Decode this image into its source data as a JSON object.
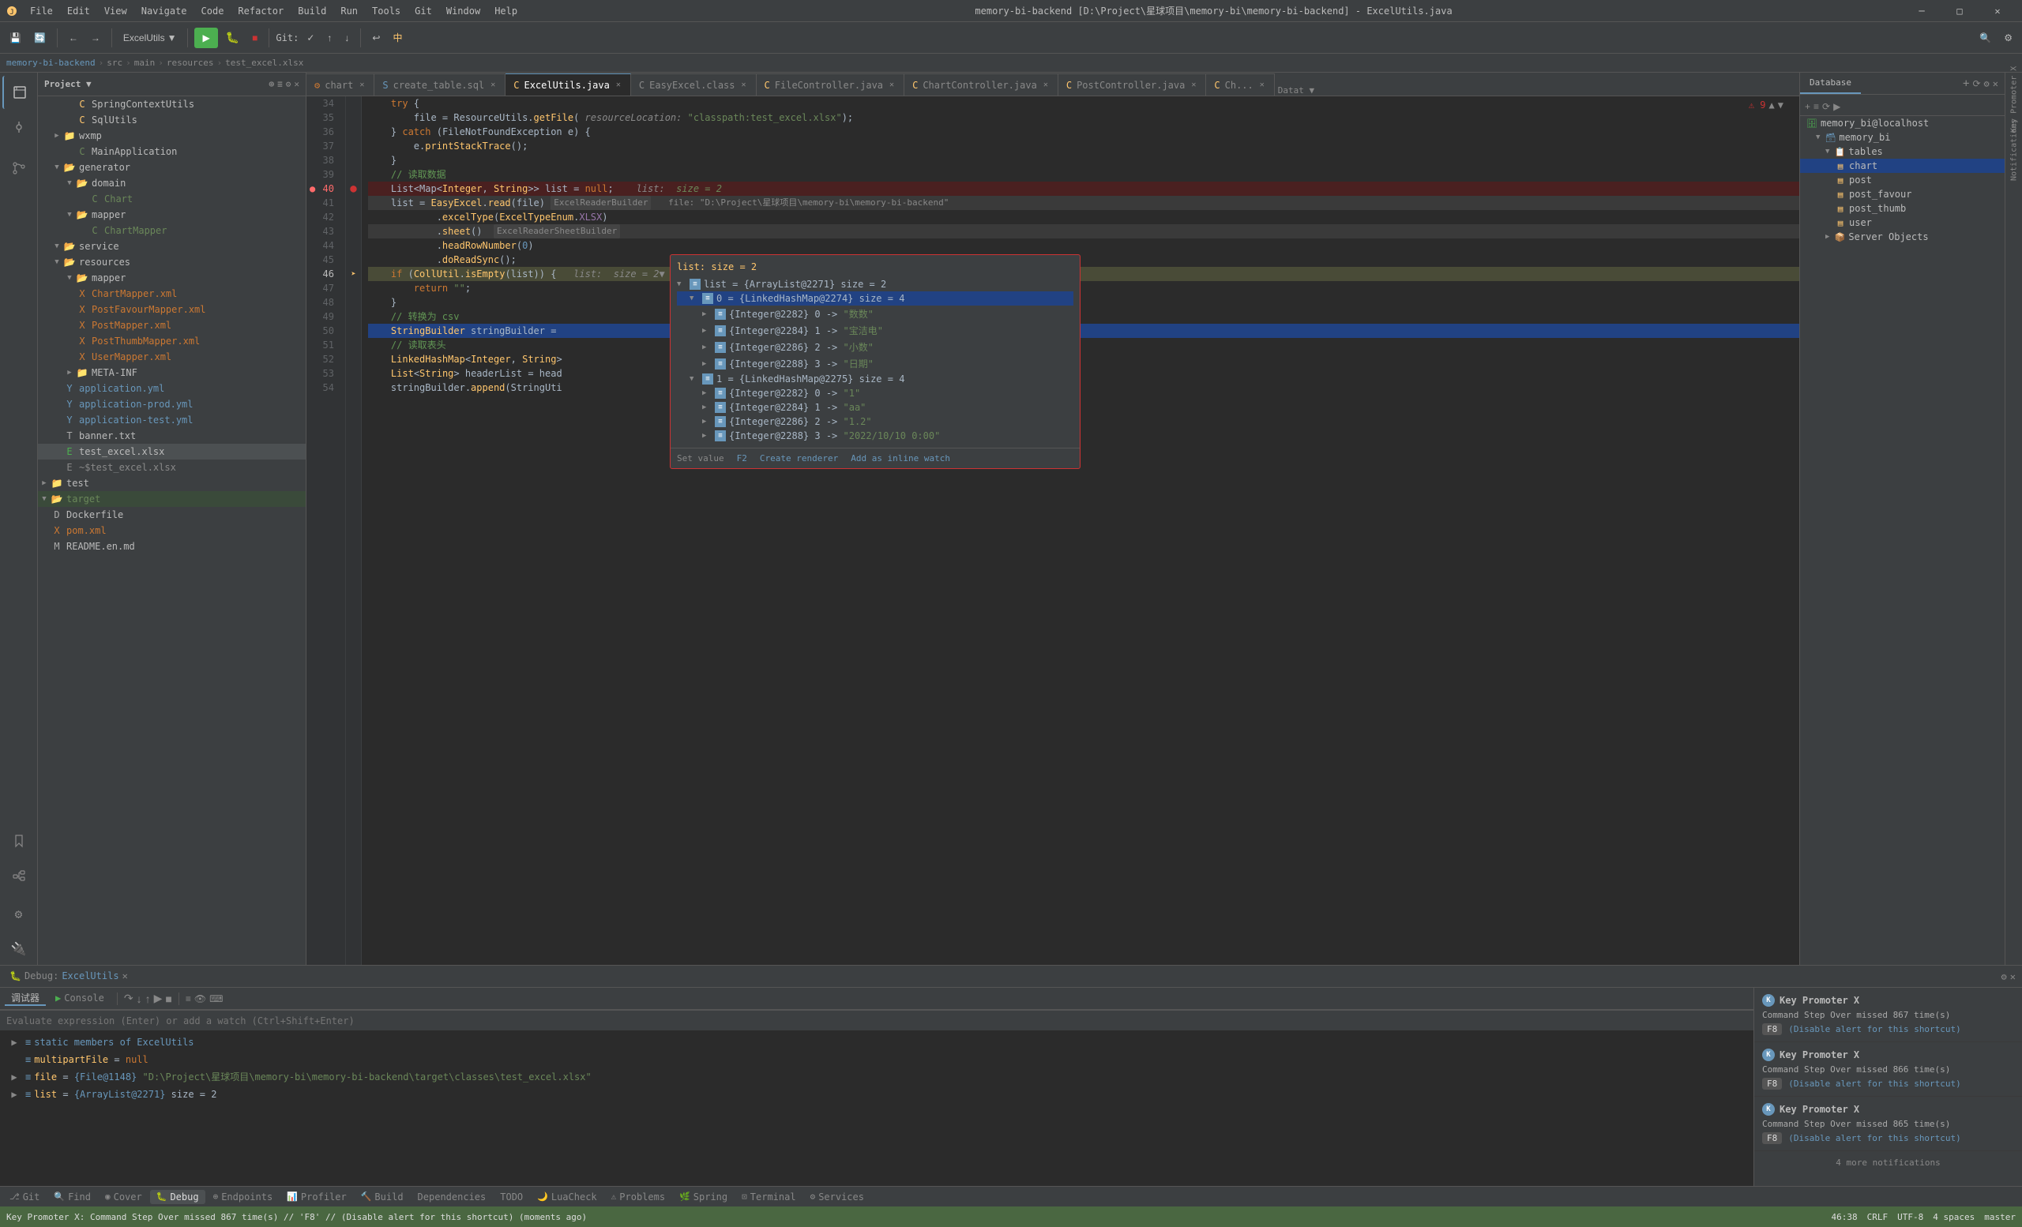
{
  "titleBar": {
    "title": "memory-bi-backend [D:\\Project\\星球项目\\memory-bi\\memory-bi-backend] - ExcelUtils.java",
    "menuItems": [
      "File",
      "Edit",
      "View",
      "Navigate",
      "Code",
      "Refactor",
      "Build",
      "Run",
      "Tools",
      "Git",
      "Window",
      "Help"
    ],
    "controls": [
      "─",
      "□",
      "✕"
    ]
  },
  "toolbar": {
    "projectName": "ExcelUtils",
    "gitStatus": "Git:",
    "runBtn": "▶",
    "debugBtn": "🐛"
  },
  "breadcrumb": {
    "items": [
      "memory-bi-backend",
      "src",
      "main",
      "resources",
      "test_excel.xlsx"
    ]
  },
  "tabs": [
    {
      "label": "chart",
      "icon": "xml",
      "active": false,
      "closeable": true
    },
    {
      "label": "create_table.sql",
      "icon": "sql",
      "active": false,
      "closeable": true
    },
    {
      "label": "ExcelUtils.java",
      "icon": "java",
      "active": true,
      "closeable": true
    },
    {
      "label": "EasyExcel.class",
      "icon": "class",
      "active": false,
      "closeable": true
    },
    {
      "label": "FileController.java",
      "icon": "java",
      "active": false,
      "closeable": true
    },
    {
      "label": "ChartController.java",
      "icon": "java",
      "active": false,
      "closeable": true
    },
    {
      "label": "PostController.java",
      "icon": "java",
      "active": false,
      "closeable": true
    },
    {
      "label": "Ch...",
      "icon": "java",
      "active": false,
      "closeable": true
    }
  ],
  "codeLines": [
    {
      "num": 34,
      "code": "    try {"
    },
    {
      "num": 35,
      "code": "        file = ResourceUtils.getFile( resourceLocation: \"classpath:test_excel.xlsx\");"
    },
    {
      "num": 36,
      "code": "    } catch (FileNotFoundException e) {"
    },
    {
      "num": 37,
      "code": "        e.printStackTrace();"
    },
    {
      "num": 38,
      "code": "    }"
    },
    {
      "num": 39,
      "code": "    // 读取数据"
    },
    {
      "num": 40,
      "code": "    List<Map<Integer, String>> list = null;    list:  size = 2",
      "debug": true,
      "breakpoint": true
    },
    {
      "num": 41,
      "code": "    list = EasyExcel.read(file) ExcelReaderBuilder   file: \"D:\\Project\\星球项目\\memory-bi\\memory-bi-backend\""
    },
    {
      "num": 42,
      "code": "            .excelType(ExcelTypeEnum.XLSX)"
    },
    {
      "num": 43,
      "code": "            .sheet()  ExcelReaderSheetBuilder"
    },
    {
      "num": 44,
      "code": "            .headRowNumber(0)"
    },
    {
      "num": 45,
      "code": "            .doReadSync();"
    },
    {
      "num": 46,
      "code": "    if (CollUtil.isEmpty(list)) {   list:  size = 2▼",
      "current": true
    },
    {
      "num": 47,
      "code": "        return \"\";"
    },
    {
      "num": 48,
      "code": "    }"
    },
    {
      "num": 49,
      "code": "    // 转换为 csv"
    },
    {
      "num": 50,
      "code": "    StringBuilder stringBuilder =",
      "selected": true
    },
    {
      "num": 51,
      "code": "    // 读取表头"
    },
    {
      "num": 52,
      "code": "    LinkedHashMap<Integer, String>"
    },
    {
      "num": 53,
      "code": "    List<String> headerList = head"
    },
    {
      "num": 54,
      "code": "    stringBuilder.append(StringUti"
    }
  ],
  "debugPopup": {
    "title": "list:  size = 2",
    "items": [
      {
        "label": "list = {ArrayList@2271}  size = 2",
        "expanded": true,
        "children": [
          {
            "label": "0 = {LinkedHashMap@2274}  size = 4",
            "expanded": true,
            "selected": true,
            "children": [
              {
                "label": "{Integer@2282} 0 -> \"数数\""
              },
              {
                "label": "{Integer@2284} 1 -> \"宝洁电\""
              },
              {
                "label": "{Integer@2286} 2 -> \"小数\""
              },
              {
                "label": "{Integer@2288} 3 -> \"日期\""
              }
            ]
          },
          {
            "label": "1 = {LinkedHashMap@2275}  size = 4",
            "expanded": true,
            "children": [
              {
                "label": "{Integer@2282} 0 -> \"1\""
              },
              {
                "label": "{Integer@2284} 1 -> \"aa\""
              },
              {
                "label": "{Integer@2286} 2 -> \"1.2\""
              },
              {
                "label": "{Integer@2288} 3 -> \"2022/10/10 0:00\""
              }
            ]
          }
        ]
      }
    ],
    "footer": {
      "setValueKey": "F2",
      "createRenderer": "Create renderer",
      "addInlineWatch": "Add as inline watch"
    }
  },
  "projectTree": {
    "title": "Project",
    "items": [
      {
        "label": "SpringContextUtils",
        "type": "java",
        "indent": 2
      },
      {
        "label": "SqlUtils",
        "type": "java",
        "indent": 2
      },
      {
        "label": "wxmp",
        "type": "folder",
        "indent": 1,
        "expanded": false
      },
      {
        "label": "MainApplication",
        "type": "java",
        "indent": 2
      },
      {
        "label": "generator",
        "type": "folder",
        "indent": 1,
        "expanded": true
      },
      {
        "label": "domain",
        "type": "folder",
        "indent": 2,
        "expanded": true
      },
      {
        "label": "Chart",
        "type": "java-green",
        "indent": 3
      },
      {
        "label": "mapper",
        "type": "folder",
        "indent": 2,
        "expanded": true
      },
      {
        "label": "ChartMapper",
        "type": "java-green",
        "indent": 3
      },
      {
        "label": "service",
        "type": "folder",
        "indent": 1,
        "expanded": true
      },
      {
        "label": "resources",
        "type": "folder",
        "indent": 1,
        "expanded": true
      },
      {
        "label": "mapper",
        "type": "folder",
        "indent": 2,
        "expanded": true
      },
      {
        "label": "ChartMapper.xml",
        "type": "xml",
        "indent": 3
      },
      {
        "label": "PostFavourMapper.xml",
        "type": "xml",
        "indent": 3
      },
      {
        "label": "PostMapper.xml",
        "type": "xml",
        "indent": 3
      },
      {
        "label": "PostThumbMapper.xml",
        "type": "xml",
        "indent": 3
      },
      {
        "label": "UserMapper.xml",
        "type": "xml",
        "indent": 3
      },
      {
        "label": "META-INF",
        "type": "folder",
        "indent": 2,
        "expanded": false
      },
      {
        "label": "application.yml",
        "type": "yml",
        "indent": 2
      },
      {
        "label": "application-prod.yml",
        "type": "yml",
        "indent": 2
      },
      {
        "label": "application-test.yml",
        "type": "yml",
        "indent": 2
      },
      {
        "label": "banner.txt",
        "type": "txt",
        "indent": 2
      },
      {
        "label": "test_excel.xlsx",
        "type": "xlsx",
        "indent": 2,
        "selected": true
      },
      {
        "label": "~$test_excel.xlsx",
        "type": "xlsx",
        "indent": 2
      },
      {
        "label": "test",
        "type": "folder",
        "indent": 0,
        "expanded": false
      },
      {
        "label": "target",
        "type": "folder",
        "indent": 0,
        "expanded": true,
        "highlighted": true
      },
      {
        "label": "Dockerfile",
        "type": "file",
        "indent": 1
      },
      {
        "label": "pom.xml",
        "type": "xml",
        "indent": 1
      },
      {
        "label": "README.en.md",
        "type": "md",
        "indent": 1
      }
    ]
  },
  "database": {
    "title": "Database",
    "server": "memory_bi@localhost",
    "database": "memory_bi",
    "tables": [
      "chart",
      "post",
      "post_favour",
      "post_thumb",
      "user"
    ],
    "serverObjects": "Server Objects"
  },
  "debugConsole": {
    "tabs": [
      "调试器",
      "Console"
    ],
    "variables": [
      {
        "label": "static members of ExcelUtils"
      },
      {
        "label": "multipartFile = null"
      },
      {
        "label": "file = {File@1148} \"D:\\Project\\星球项目\\memory-bi\\memory-bi-backend\\target\\classes\\test_excel.xlsx\""
      },
      {
        "label": "list = {ArrayList@2271}  size = 2"
      }
    ],
    "inputPlaceholder": "Evaluate expression (Enter) or add a watch (Ctrl+Shift+Enter)"
  },
  "keyPromoter": {
    "title": "Key Promoter X",
    "notifications": [
      {
        "title": "Key Promoter X",
        "command": "Command Step Over missed 867 time(s)",
        "shortcutKey": "F8",
        "disableText": "(Disable alert for this shortcut)"
      },
      {
        "title": "Key Promoter X",
        "command": "Command Step Over missed 866 time(s)",
        "shortcutKey": "F8",
        "disableText": "(Disable alert for this shortcut)"
      },
      {
        "title": "Key Promoter X",
        "command": "Command Step Over missed 865 time(s)",
        "shortcutKey": "F8",
        "disableText": "(Disable alert for this shortcut)"
      },
      {
        "moreText": "4 more notifications"
      }
    ]
  },
  "bottomTabs": [
    "Git",
    "Find",
    "Cover",
    "Debug",
    "Endpoints",
    "Profiler",
    "Build",
    "Dependencies",
    "TODO",
    "LuaCheck",
    "Problems",
    "Spring",
    "Terminal",
    "Services"
  ],
  "statusBar": {
    "debugMode": "Debug: ExcelUtils",
    "line": "46:38",
    "encoding": "CRLF",
    "charset": "UTF-8",
    "indent": "4 spaces",
    "branch": "master"
  },
  "bottomStatusBar": {
    "message": "Key Promoter X: Command Step Over missed 867 time(s) // 'F8' // (Disable alert for this shortcut) (moments ago)"
  }
}
